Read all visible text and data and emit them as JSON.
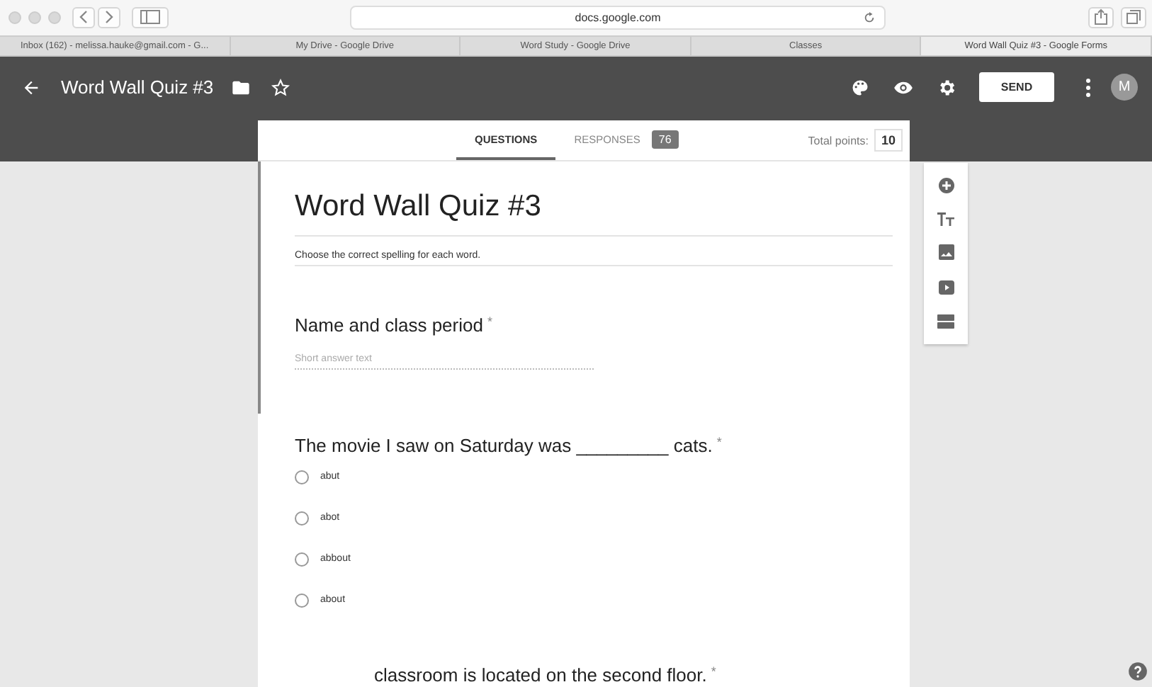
{
  "browser": {
    "address": "docs.google.com",
    "tabs": [
      {
        "label": "Inbox (162) - melissa.hauke@gmail.com - G...",
        "selected": false
      },
      {
        "label": "My Drive - Google Drive",
        "selected": false
      },
      {
        "label": "Word Study - Google Drive",
        "selected": false
      },
      {
        "label": "Classes",
        "selected": false
      },
      {
        "label": "Word Wall Quiz #3 - Google Forms",
        "selected": true
      }
    ]
  },
  "header": {
    "title": "Word Wall Quiz #3",
    "send": "SEND",
    "avatar": "M"
  },
  "nav": {
    "tabs": [
      {
        "label": "QUESTIONS",
        "selected": true
      },
      {
        "label": "RESPONSES",
        "selected": false,
        "badge": "76"
      }
    ],
    "points_label": "Total points:",
    "points": "10"
  },
  "form": {
    "title": "Word Wall Quiz #3",
    "description": "Choose the correct spelling for each word.",
    "selected": true,
    "questions": [
      {
        "kind": "short",
        "title": "Name and class period",
        "required_mark": "*",
        "placeholder": "Short answer text"
      },
      {
        "kind": "choice",
        "title": "The movie I saw on Saturday was _________ cats.",
        "required_mark": "*",
        "options": [
          {
            "label": "abut",
            "selected": false
          },
          {
            "label": "abot",
            "selected": false
          },
          {
            "label": "abbout",
            "selected": false
          },
          {
            "label": "about",
            "selected": false
          }
        ]
      },
      {
        "kind": "partial",
        "title": "classroom is located on the second floor.",
        "required_mark": "*"
      }
    ]
  }
}
